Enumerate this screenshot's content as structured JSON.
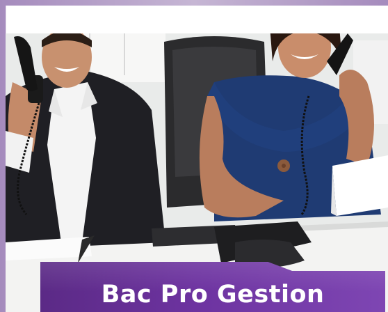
{
  "banner": {
    "title": "Bac Pro Gestion",
    "color_start": "#5b2a86",
    "color_end": "#7e46b3",
    "text_color": "#ffffff"
  }
}
